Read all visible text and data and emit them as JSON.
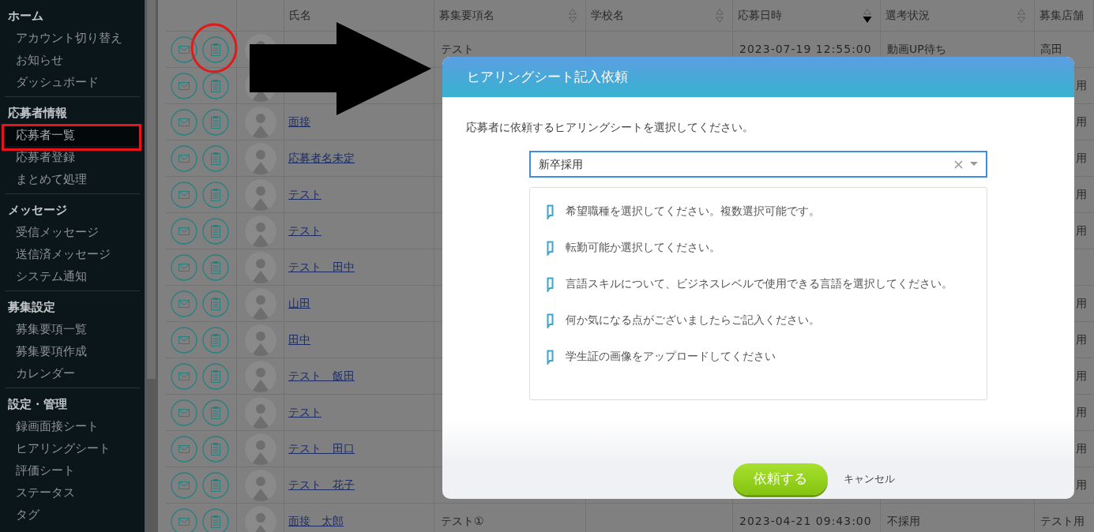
{
  "sidebar": {
    "sections": [
      {
        "title": "ホーム",
        "items": [
          {
            "label": "アカウント切り替え",
            "selected": false
          },
          {
            "label": "お知らせ",
            "selected": false
          },
          {
            "label": "ダッシュボード",
            "selected": false
          }
        ]
      },
      {
        "title": "応募者情報",
        "items": [
          {
            "label": "応募者一覧",
            "selected": true
          },
          {
            "label": "応募者登録",
            "selected": false
          },
          {
            "label": "まとめて処理",
            "selected": false
          }
        ]
      },
      {
        "title": "メッセージ",
        "items": [
          {
            "label": "受信メッセージ",
            "selected": false
          },
          {
            "label": "送信済メッセージ",
            "selected": false
          },
          {
            "label": "システム通知",
            "selected": false
          }
        ]
      },
      {
        "title": "募集設定",
        "items": [
          {
            "label": "募集要項一覧",
            "selected": false
          },
          {
            "label": "募集要項作成",
            "selected": false
          },
          {
            "label": "カレンダー",
            "selected": false
          }
        ]
      },
      {
        "title": "設定・管理",
        "items": [
          {
            "label": "録画面接シート",
            "selected": false
          },
          {
            "label": "ヒアリングシート",
            "selected": false
          },
          {
            "label": "評価シート",
            "selected": false
          },
          {
            "label": "ステータス",
            "selected": false
          },
          {
            "label": "タグ",
            "selected": false
          }
        ]
      }
    ]
  },
  "table": {
    "columns": [
      {
        "label": "氏名",
        "sortable": false
      },
      {
        "label": "募集要項名",
        "sortable": true,
        "sorted_desc": false
      },
      {
        "label": "学校名",
        "sortable": true,
        "sorted_desc": false
      },
      {
        "label": "応募日時",
        "sortable": true,
        "sorted_desc": true
      },
      {
        "label": "選考状況",
        "sortable": true,
        "sorted_desc": false
      },
      {
        "label": "募集店舗",
        "sortable": false
      }
    ],
    "rows": [
      {
        "job": "テスト",
        "date": "2023-07-19 12:55:00",
        "status": "動画UP待ち",
        "store": "高田"
      },
      {
        "store": "用"
      },
      {
        "name": "面接",
        "store": "用"
      },
      {
        "name": "応募者名未定",
        "store": "用"
      },
      {
        "name": "テスト",
        "store": "用"
      },
      {
        "name": "テスト",
        "store": "用"
      },
      {
        "name": "テスト　田中"
      },
      {
        "name": "山田",
        "store": "用"
      },
      {
        "name": "田中",
        "store": "用"
      },
      {
        "name": "テスト　飯田",
        "store": "用"
      },
      {
        "name": "テスト",
        "store": "用"
      },
      {
        "name": "テスト　田口",
        "store": "用"
      },
      {
        "name": "テスト　花子",
        "store": "用"
      },
      {
        "name": "面接　太郎",
        "job": "テスト①",
        "date": "2023-04-21 09:43:00",
        "status": "不採用",
        "store": "テスト用"
      }
    ]
  },
  "modal": {
    "title": "ヒアリングシート記入依頼",
    "prompt": "応募者に依頼するヒアリングシートを選択してください。",
    "select": {
      "value": "新卒採用"
    },
    "questions": [
      "希望職種を選択してください。複数選択可能です。",
      "転勤可能か選択してください。",
      "言語スキルについて、ビジネスレベルで使用できる言語を選択してください。",
      "何か気になる点がございましたらご記入ください。",
      "学生証の画像をアップロードしてください"
    ],
    "submit": "依頼する",
    "cancel": "キャンセル"
  }
}
